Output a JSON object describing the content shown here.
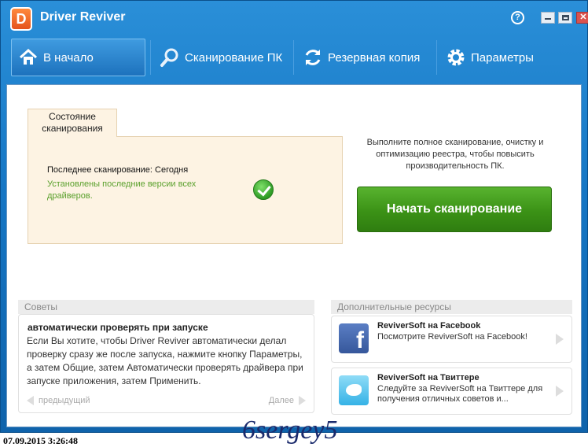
{
  "app": {
    "title": "Driver Reviver",
    "logo_letter": "D"
  },
  "window_controls": {
    "help": "?",
    "close": "✕"
  },
  "nav": {
    "items": [
      {
        "label": "В начало",
        "icon": "home-icon",
        "active": true
      },
      {
        "label": "Сканирование ПК",
        "icon": "magnifier-icon",
        "active": false
      },
      {
        "label": "Резервная копия",
        "icon": "refresh-icon",
        "active": false
      },
      {
        "label": "Параметры",
        "icon": "gear-icon",
        "active": false
      }
    ]
  },
  "status": {
    "tab_label": "Состояние сканирования",
    "last_scan": "Последнее сканирование: Сегодня",
    "message": "Установлены последние версии всех драйверов."
  },
  "promo": {
    "text": "Выполните полное сканирование, очистку и оптимизацию реестра, чтобы повысить производительность ПК.",
    "scan_button": "Начать сканирование"
  },
  "tips": {
    "header": "Советы",
    "title": "автоматически проверять при запуске",
    "body": "Если Вы хотите, чтобы Driver Reviver автоматически делал проверку сразу же после запуска, нажмите кнопку Параметры, а затем Общие, затем Автоматически проверять драйвера при запуске приложения, затем Применить.",
    "prev": "предыдущий",
    "next": "Далее"
  },
  "resources": {
    "header": "Дополнительные ресурсы",
    "items": [
      {
        "title": "ReviverSoft на Facebook",
        "desc": "Посмотрите ReviverSoft на Facebook!",
        "icon": "facebook-icon"
      },
      {
        "title": "ReviverSoft на Твиттере",
        "desc": "Следуйте за ReviverSoft на Твиттере для получения отличных советов и...",
        "icon": "twitter-icon"
      }
    ]
  },
  "footer": {
    "timestamp": "07.09.2015 3:26:48",
    "watermark": "6sergey5"
  },
  "colors": {
    "titlebar": "#1676c4",
    "scan_button": "#3b9216",
    "status_ok": "#5aa02c",
    "status_bg": "#fdf3e3"
  }
}
